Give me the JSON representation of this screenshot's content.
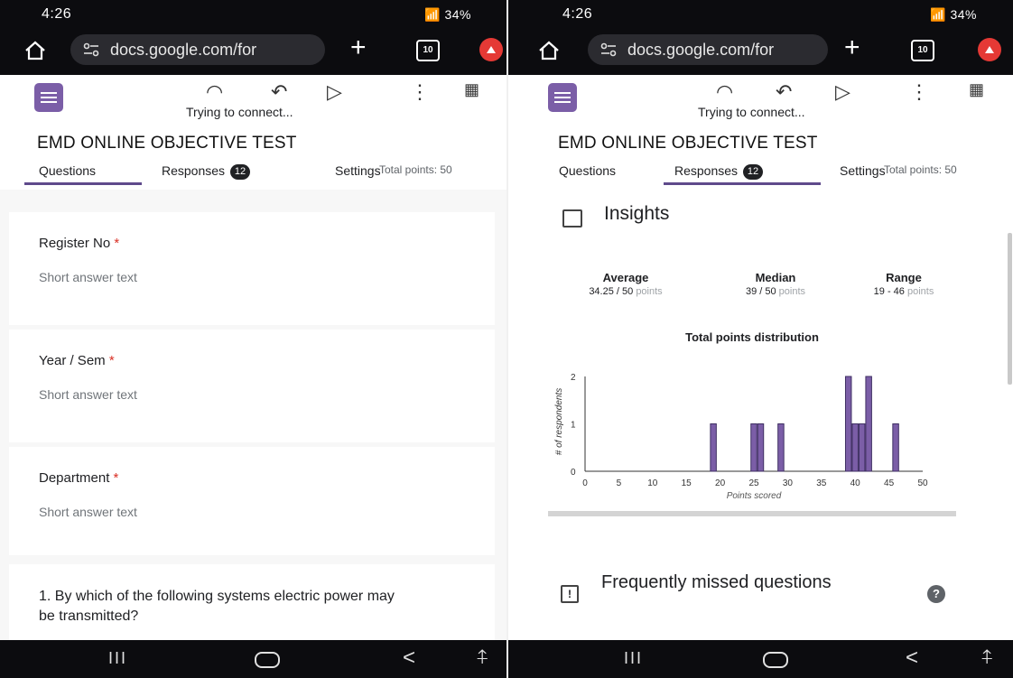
{
  "status_bar": {
    "time": "4:26",
    "indicators": "34%"
  },
  "browser": {
    "url": "docs.google.com/for",
    "tab_count": "10"
  },
  "toolbar": {
    "connecting": "Trying to connect..."
  },
  "form": {
    "title": "EMD ONLINE OBJECTIVE TEST",
    "total_points": "Total points: 50"
  },
  "tabs": {
    "questions": "Questions",
    "responses": "Responses",
    "responses_count": "12",
    "settings": "Settings"
  },
  "questions": [
    {
      "label": "Register No",
      "required": "*",
      "hint": "Short answer text"
    },
    {
      "label": "Year / Sem",
      "required": "*",
      "hint": "Short answer text"
    },
    {
      "label": "Department",
      "required": "*",
      "hint": "Short answer text"
    },
    {
      "label": "1. By which of the following systems electric power may be transmitted?"
    }
  ],
  "insights": {
    "title": "Insights",
    "average_label": "Average",
    "average_value": "34.25 / 50",
    "median_label": "Median",
    "median_value": "39 / 50",
    "range_label": "Range",
    "range_value": "19 - 46",
    "points_unit": "points"
  },
  "chart_data": {
    "type": "bar",
    "title": "Total points distribution",
    "xlabel": "Points scored",
    "ylabel": "# of respondents",
    "xlim": [
      0,
      50
    ],
    "ylim": [
      0,
      2
    ],
    "x_ticks": [
      0,
      5,
      10,
      15,
      20,
      25,
      30,
      35,
      40,
      45,
      50
    ],
    "y_ticks": [
      0,
      1,
      2
    ],
    "x": [
      19,
      25,
      26,
      29,
      39,
      40,
      41,
      42,
      46
    ],
    "values": [
      1,
      1,
      1,
      1,
      2,
      1,
      1,
      2,
      1
    ],
    "colors": {
      "bar": "#7b5ea7",
      "bar_border": "#3f2f63"
    }
  },
  "missed": {
    "title": "Frequently missed questions",
    "help": "?"
  },
  "nav": {
    "recent": "III",
    "back": "<"
  }
}
